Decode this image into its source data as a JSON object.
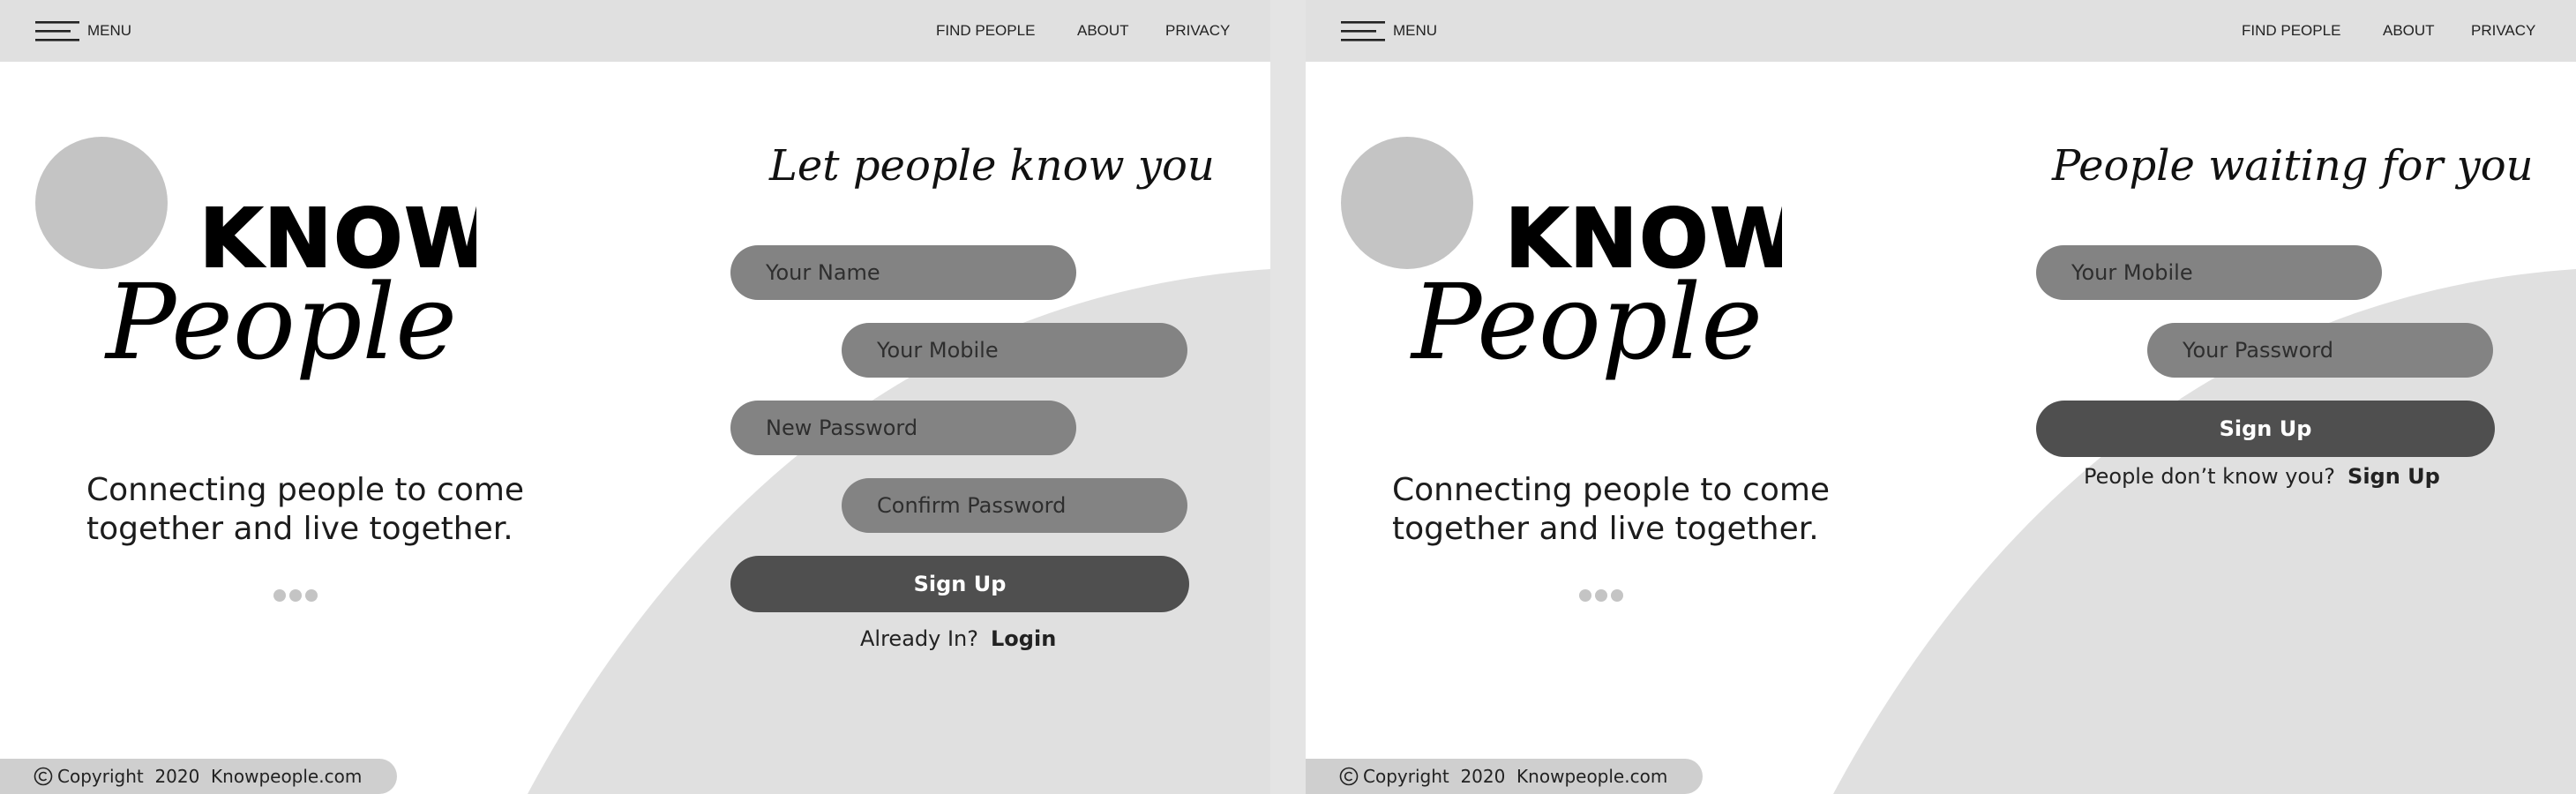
{
  "colors": {
    "topbar": "#e0e0e0",
    "curve": "#e0e0e0",
    "avatar": "#c4c4c4",
    "field": "#838383",
    "button": "#4f4f4f",
    "footer": "#cfcfcf"
  },
  "left_screen": {
    "nav": {
      "menu_label": "MENU",
      "items": [
        "FIND PEOPLE",
        "ABOUT",
        "PRIVACY"
      ]
    },
    "logo": {
      "line1": "KNOW",
      "line2": "People"
    },
    "tagline": "Connecting people to come together and live together.",
    "form": {
      "title": "Let people know you",
      "name_placeholder": "Your Name",
      "mobile_placeholder": "Your Mobile",
      "new_password_placeholder": "New Password",
      "confirm_password_placeholder": "Confirm Password",
      "button_label": "Sign Up",
      "prompt": "Already In?",
      "link_label": "Login"
    },
    "footer": {
      "copyright": "Copyright  2020  Knowpeople.com"
    }
  },
  "right_screen": {
    "nav": {
      "menu_label": "MENU",
      "items": [
        "FIND PEOPLE",
        "ABOUT",
        "PRIVACY"
      ]
    },
    "logo": {
      "line1": "KNOW",
      "line2": "People"
    },
    "tagline": "Connecting people to come together and live together.",
    "form": {
      "title": "People waiting for you",
      "mobile_placeholder": "Your Mobile",
      "password_placeholder": "Your Password",
      "button_label": "Sign Up",
      "prompt": "People don’t know you?",
      "link_label": "Sign Up"
    },
    "footer": {
      "copyright": "Copyright  2020  Knowpeople.com"
    }
  }
}
